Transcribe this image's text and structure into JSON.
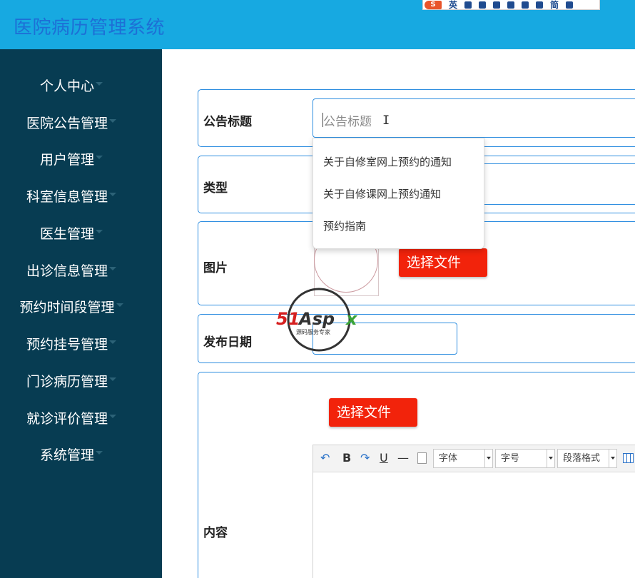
{
  "app": {
    "title": "医院病历管理系统"
  },
  "ime_bar": {
    "lang": "英",
    "mode": "简"
  },
  "sidebar": {
    "items": [
      {
        "label": "个人中心"
      },
      {
        "label": "医院公告管理"
      },
      {
        "label": "用户管理"
      },
      {
        "label": "科室信息管理"
      },
      {
        "label": "医生管理"
      },
      {
        "label": "出诊信息管理"
      },
      {
        "label": "预约时间段管理"
      },
      {
        "label": "预约挂号管理"
      },
      {
        "label": "门诊病历管理"
      },
      {
        "label": "就诊评价管理"
      },
      {
        "label": "系统管理"
      }
    ]
  },
  "form": {
    "title_field": {
      "label": "公告标题",
      "placeholder": "公告标题"
    },
    "type_field": {
      "label": "类型"
    },
    "image_field": {
      "label": "图片",
      "upload_button": "选择文件"
    },
    "date_field": {
      "label": "发布日期"
    },
    "content_field": {
      "label": "内容",
      "upload_button": "选择文件"
    }
  },
  "autocomplete": {
    "options": [
      "关于自修室网上预约的通知",
      "关于自修课网上预约通知",
      "预约指南"
    ]
  },
  "editor": {
    "toolbar": {
      "undo_icon": "undo-icon",
      "bold": "B",
      "redo_icon": "redo-icon",
      "underline": "U",
      "horizontal_rule": "—",
      "font_family": "字体",
      "font_size": "字号",
      "paragraph_format": "段落格式"
    }
  },
  "watermark": {
    "brand": "51Aspx",
    "tagline": "源码服务专家"
  },
  "colors": {
    "header": "#17a9e1",
    "sidebar": "#073c52",
    "accent": "#2f8ee0",
    "button": "#f2230b"
  }
}
